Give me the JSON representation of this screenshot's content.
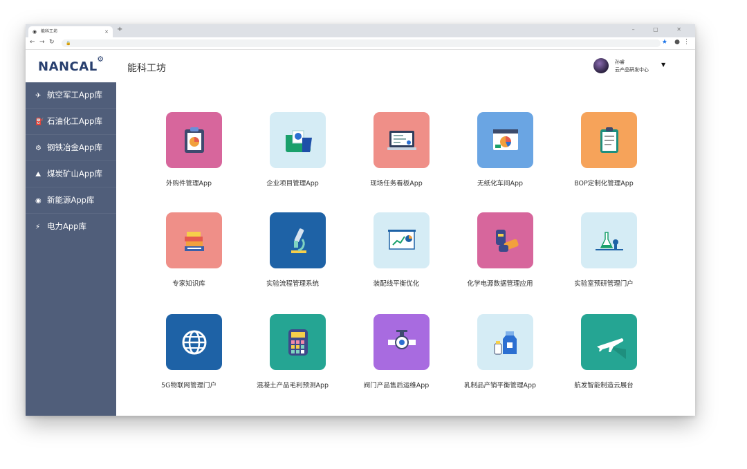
{
  "browser": {
    "tab_title": "能科工坊",
    "tab_close": "×",
    "new_tab": "+",
    "url_prefix": "🔒",
    "window_controls": "–  ▢  ✕"
  },
  "header": {
    "logo": "NANCAL",
    "app_title": "能科工坊",
    "user_name": "孙睿",
    "user_dept": "云产品研发中心"
  },
  "sidebar": {
    "items": [
      {
        "label": "航空军工App库",
        "icon": "✈"
      },
      {
        "label": "石油化工App库",
        "icon": "⛽"
      },
      {
        "label": "钢铁冶金App库",
        "icon": "⚙"
      },
      {
        "label": "煤炭矿山App库",
        "icon": "⛰"
      },
      {
        "label": "新能源App库",
        "icon": "◉"
      },
      {
        "label": "电力App库",
        "icon": "⚡"
      }
    ]
  },
  "apps": [
    {
      "label": "外购件管理App",
      "color": "#d7669c",
      "icon": "clipboard-pie-icon"
    },
    {
      "label": "企业项目管理App",
      "color": "#d5ecf5",
      "icon": "folder-chart-icon"
    },
    {
      "label": "现场任务看板App",
      "color": "#ef8f88",
      "icon": "laptop-board-icon"
    },
    {
      "label": "无纸化车间App",
      "color": "#6aa5e3",
      "icon": "browser-pie-icon"
    },
    {
      "label": "BOP定制化管理App",
      "color": "#f6a35a",
      "icon": "clipboard-list-icon"
    },
    {
      "label": "专家知识库",
      "color": "#ef8f88",
      "icon": "books-icon"
    },
    {
      "label": "实验流程管理系统",
      "color": "#1e62a6",
      "icon": "microscope-icon"
    },
    {
      "label": "装配线平衡优化",
      "color": "#d5ecf5",
      "icon": "presentation-chart-icon"
    },
    {
      "label": "化学电源数据管理应用",
      "color": "#d7669c",
      "icon": "batteries-icon"
    },
    {
      "label": "实验室预研管理门户",
      "color": "#d5ecf5",
      "icon": "lab-flask-icon"
    },
    {
      "label": "5G物联网管理门户",
      "color": "#1e62a6",
      "icon": "globe-icon"
    },
    {
      "label": "混凝土产品毛利预测App",
      "color": "#25a593",
      "icon": "calculator-icon"
    },
    {
      "label": "阀门产品售后运维App",
      "color": "#a86be0",
      "icon": "valve-icon"
    },
    {
      "label": "乳制品产销平衡管理App",
      "color": "#d5ecf5",
      "icon": "milk-icon"
    },
    {
      "label": "航发智能制造云展台",
      "color": "#25a593",
      "icon": "airplane-icon"
    }
  ]
}
